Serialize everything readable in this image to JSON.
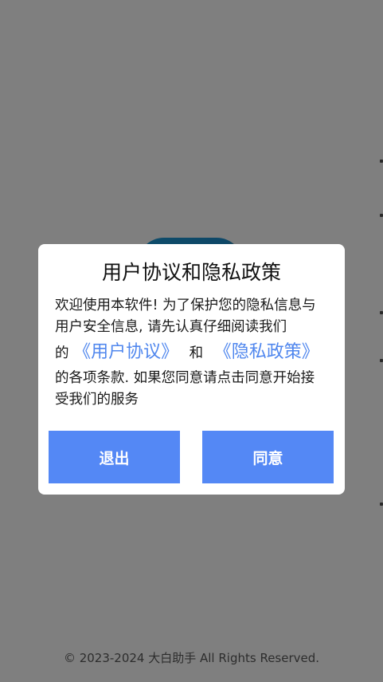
{
  "footer": {
    "copyright": "© 2023-2024 大白助手 All Rights Reserved."
  },
  "dialog": {
    "title": "用户协议和隐私政策",
    "body_intro": "欢迎使用本软件! 为了保护您的隐私信息与用户安全信息, 请先认真仔细阅读我们",
    "body_of": "的",
    "user_agreement_link": "《用户协议》",
    "body_and": "和",
    "privacy_policy_link": "《隐私政策》",
    "body_outro": "的各项条款. 如果您同意请点击同意开始接受我们的服务",
    "exit_label": "退出",
    "agree_label": "同意"
  },
  "colors": {
    "scrim": "#808080",
    "button": "#5488f5",
    "link": "#5087ee"
  }
}
